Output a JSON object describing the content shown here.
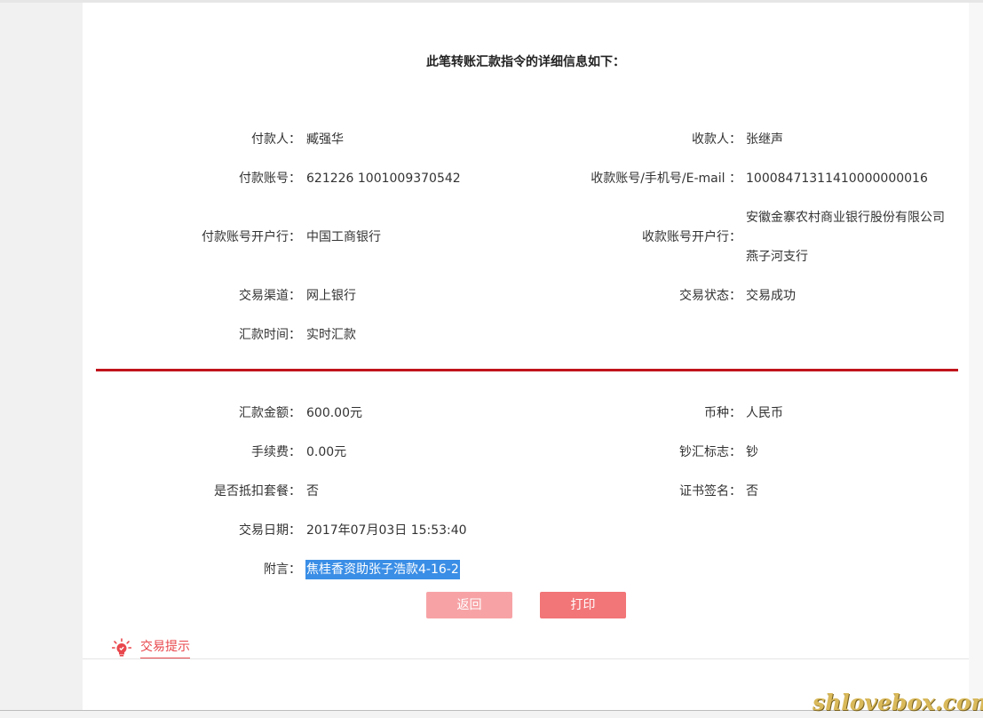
{
  "title": "此笔转账汇款指令的详细信息如下：",
  "top_section": [
    {
      "left_label": "付款人：",
      "left_value": "臧强华",
      "right_label": "收款人：",
      "right_value": "张继声"
    },
    {
      "left_label": "付款账号：",
      "left_value": "621226 1001009370542",
      "right_label": "收款账号/手机号/E-mail ：",
      "right_value": "10008471311410000000016"
    },
    {
      "left_label": "付款账号开户行：",
      "left_value": "中国工商银行",
      "right_label": "收款账号开户行：",
      "right_value_line1": "安徽金寨农村商业银行股份有限公司",
      "right_value_line2": "燕子河支行"
    },
    {
      "left_label": "交易渠道：",
      "left_value": "网上银行",
      "right_label": "交易状态：",
      "right_value": "交易成功"
    },
    {
      "left_label": "汇款时间：",
      "left_value": "实时汇款"
    }
  ],
  "bottom_section": [
    {
      "left_label": "汇款金额：",
      "left_value": "600.00元",
      "right_label": "币种：",
      "right_value": "人民币"
    },
    {
      "left_label": "手续费：",
      "left_value": "0.00元",
      "right_label": "钞汇标志：",
      "right_value": "钞"
    },
    {
      "left_label": "是否抵扣套餐：",
      "left_value": "否",
      "right_label": "证书签名：",
      "right_value": "否"
    },
    {
      "left_label": "交易日期：",
      "left_value": "2017年07月03日 15:53:40"
    },
    {
      "left_label": "附言：",
      "left_value": "焦桂香资助张子浩款4-16-2"
    }
  ],
  "buttons": {
    "back": "返回",
    "print": "打印"
  },
  "tips": {
    "label": "交易提示",
    "icon": "lightbulb-icon"
  },
  "watermark": "shlovebox.com",
  "colors": {
    "accent_red": "#c0141c",
    "button_back": "#f7a3a6",
    "button_print": "#f27577",
    "tips_red": "#e8474c",
    "highlight": "#3a8ee6"
  }
}
